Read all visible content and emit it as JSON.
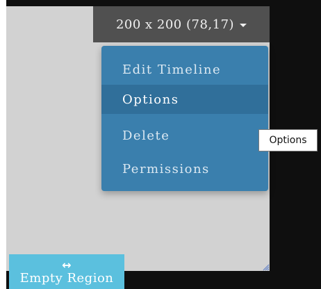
{
  "region": {
    "size_label": "200 x 200 (78,17)",
    "dropdown_icon": "caret-down-icon",
    "name_label": "Empty Region",
    "move_icon": "↔",
    "move_icon_name": "move-horizontal-icon"
  },
  "menu": {
    "items": [
      {
        "label": "Edit Timeline",
        "active": false
      },
      {
        "label": "Options",
        "active": true
      },
      {
        "label": "Delete",
        "active": false
      },
      {
        "label": "Permissions",
        "active": false
      }
    ]
  },
  "tooltip": {
    "text": "Options"
  },
  "colors": {
    "menu_bg": "#3a7fad",
    "menu_active": "#306f9a",
    "region_bg": "#d2d2d2",
    "tab_bg": "#5bc0de",
    "dropdown_bg": "#505050",
    "page_bg": "#0f0f0f"
  }
}
